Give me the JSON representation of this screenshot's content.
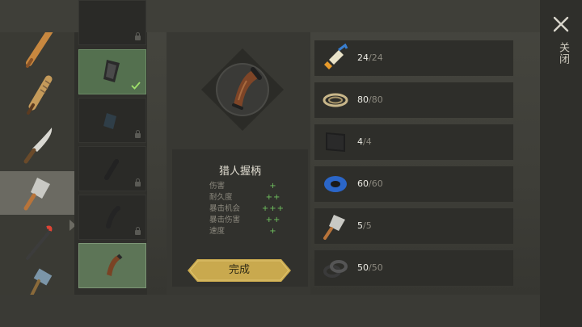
{
  "close": {
    "label": "关闭",
    "icon": "close-icon"
  },
  "weapons": [
    {
      "name": "baseball-bat-icon"
    },
    {
      "name": "wrapped-bat-icon"
    },
    {
      "name": "machete-icon"
    },
    {
      "name": "cleaver-icon",
      "selected": true
    },
    {
      "name": "crowbar-icon"
    },
    {
      "name": "sledgehammer-icon"
    }
  ],
  "handles": [
    {
      "state": "locked"
    },
    {
      "state": "equipped"
    },
    {
      "state": "locked"
    },
    {
      "state": "locked"
    },
    {
      "state": "locked"
    },
    {
      "state": "selected"
    }
  ],
  "item": {
    "title": "猎人握柄",
    "icon": "hunter-grip-icon",
    "stats": [
      {
        "label": "伤害",
        "value": "+"
      },
      {
        "label": "耐久度",
        "value": "++"
      },
      {
        "label": "暴击机会",
        "value": "+++"
      },
      {
        "label": "暴击伤害",
        "value": "++"
      },
      {
        "label": "速度",
        "value": "+"
      }
    ]
  },
  "craft_button": {
    "label": "完成"
  },
  "requirements": [
    {
      "icon": "glue-icon",
      "have": "24",
      "need": "/24"
    },
    {
      "icon": "rope-icon",
      "have": "80",
      "need": "/80"
    },
    {
      "icon": "leather-icon",
      "have": "4",
      "need": "/4"
    },
    {
      "icon": "duct-tape-icon",
      "have": "60",
      "need": "/60"
    },
    {
      "icon": "cleaver-icon",
      "have": "5",
      "need": "/5"
    },
    {
      "icon": "washers-icon",
      "have": "50",
      "need": "/50"
    }
  ],
  "colors": {
    "accent_gold": "#c9a94e",
    "plus_green": "#6fc05e",
    "equipped_green": "#54704f"
  }
}
